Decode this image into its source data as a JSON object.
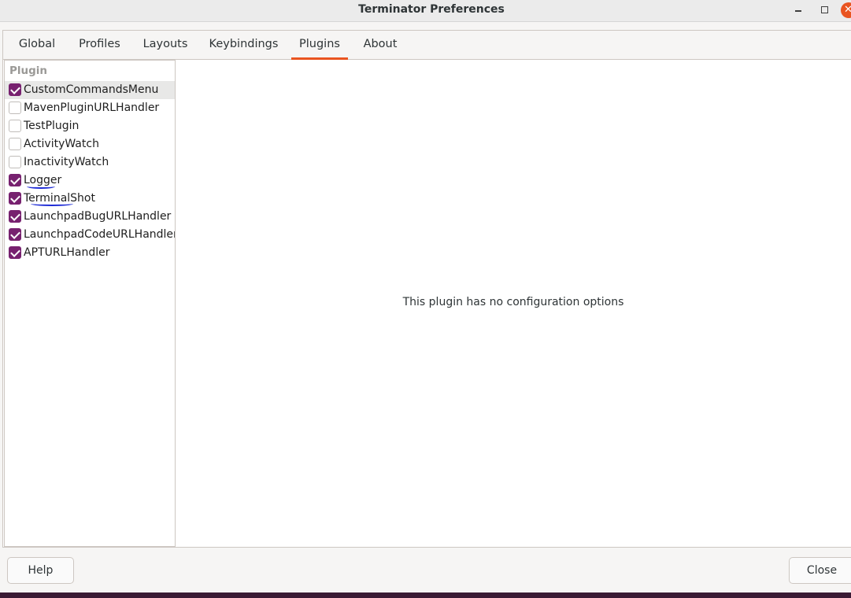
{
  "window": {
    "title": "Terminator Preferences",
    "minimize_icon": "minimize-icon",
    "maximize_icon": "maximize-icon",
    "close_icon": "close-icon",
    "close_glyph": "✕"
  },
  "tabs": [
    {
      "label": "Global"
    },
    {
      "label": "Profiles"
    },
    {
      "label": "Layouts"
    },
    {
      "label": "Keybindings"
    },
    {
      "label": "Plugins",
      "active": true
    },
    {
      "label": "About"
    }
  ],
  "plugins": {
    "column_header": "Plugin",
    "items": [
      {
        "label": "CustomCommandsMenu",
        "checked": true,
        "selected": true
      },
      {
        "label": "MavenPluginURLHandler",
        "checked": false
      },
      {
        "label": "TestPlugin",
        "checked": false
      },
      {
        "label": "ActivityWatch",
        "checked": false
      },
      {
        "label": "InactivityWatch",
        "checked": false
      },
      {
        "label": "Logger",
        "checked": true
      },
      {
        "label": "TerminalShot",
        "checked": true
      },
      {
        "label": "LaunchpadBugURLHandler",
        "checked": true
      },
      {
        "label": "LaunchpadCodeURLHandler",
        "checked": true
      },
      {
        "label": "APTURLHandler",
        "checked": true
      }
    ]
  },
  "config": {
    "message": "This plugin has no configuration options"
  },
  "footer": {
    "help_label": "Help",
    "close_label": "Close"
  },
  "colors": {
    "accent": "#e95420",
    "checkbox": "#77216f",
    "annotation": "#1e2bd6"
  }
}
